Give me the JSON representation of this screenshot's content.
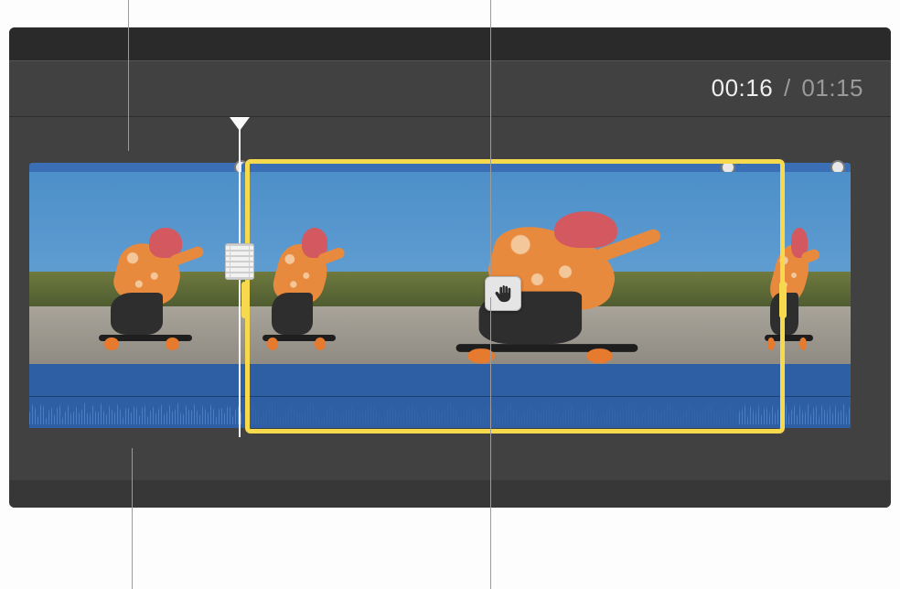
{
  "time": {
    "current": "00:16",
    "separator": "/",
    "total": "01:15"
  },
  "icons": {
    "freeze_badge": "hand-stop-icon",
    "playhead_marker": "filmstrip-icon"
  },
  "colors": {
    "selection": "#f7d94e",
    "speed_bar": "#3b6fb5",
    "audio_track": "#2e5fa5",
    "background": "#414141"
  },
  "clips": [
    {
      "role": "pre",
      "has_audio_waveform": true
    },
    {
      "role": "freeze",
      "has_audio_waveform": false,
      "selected": true,
      "badge": "hand-stop-icon"
    },
    {
      "role": "post",
      "has_audio_waveform": true
    }
  ]
}
